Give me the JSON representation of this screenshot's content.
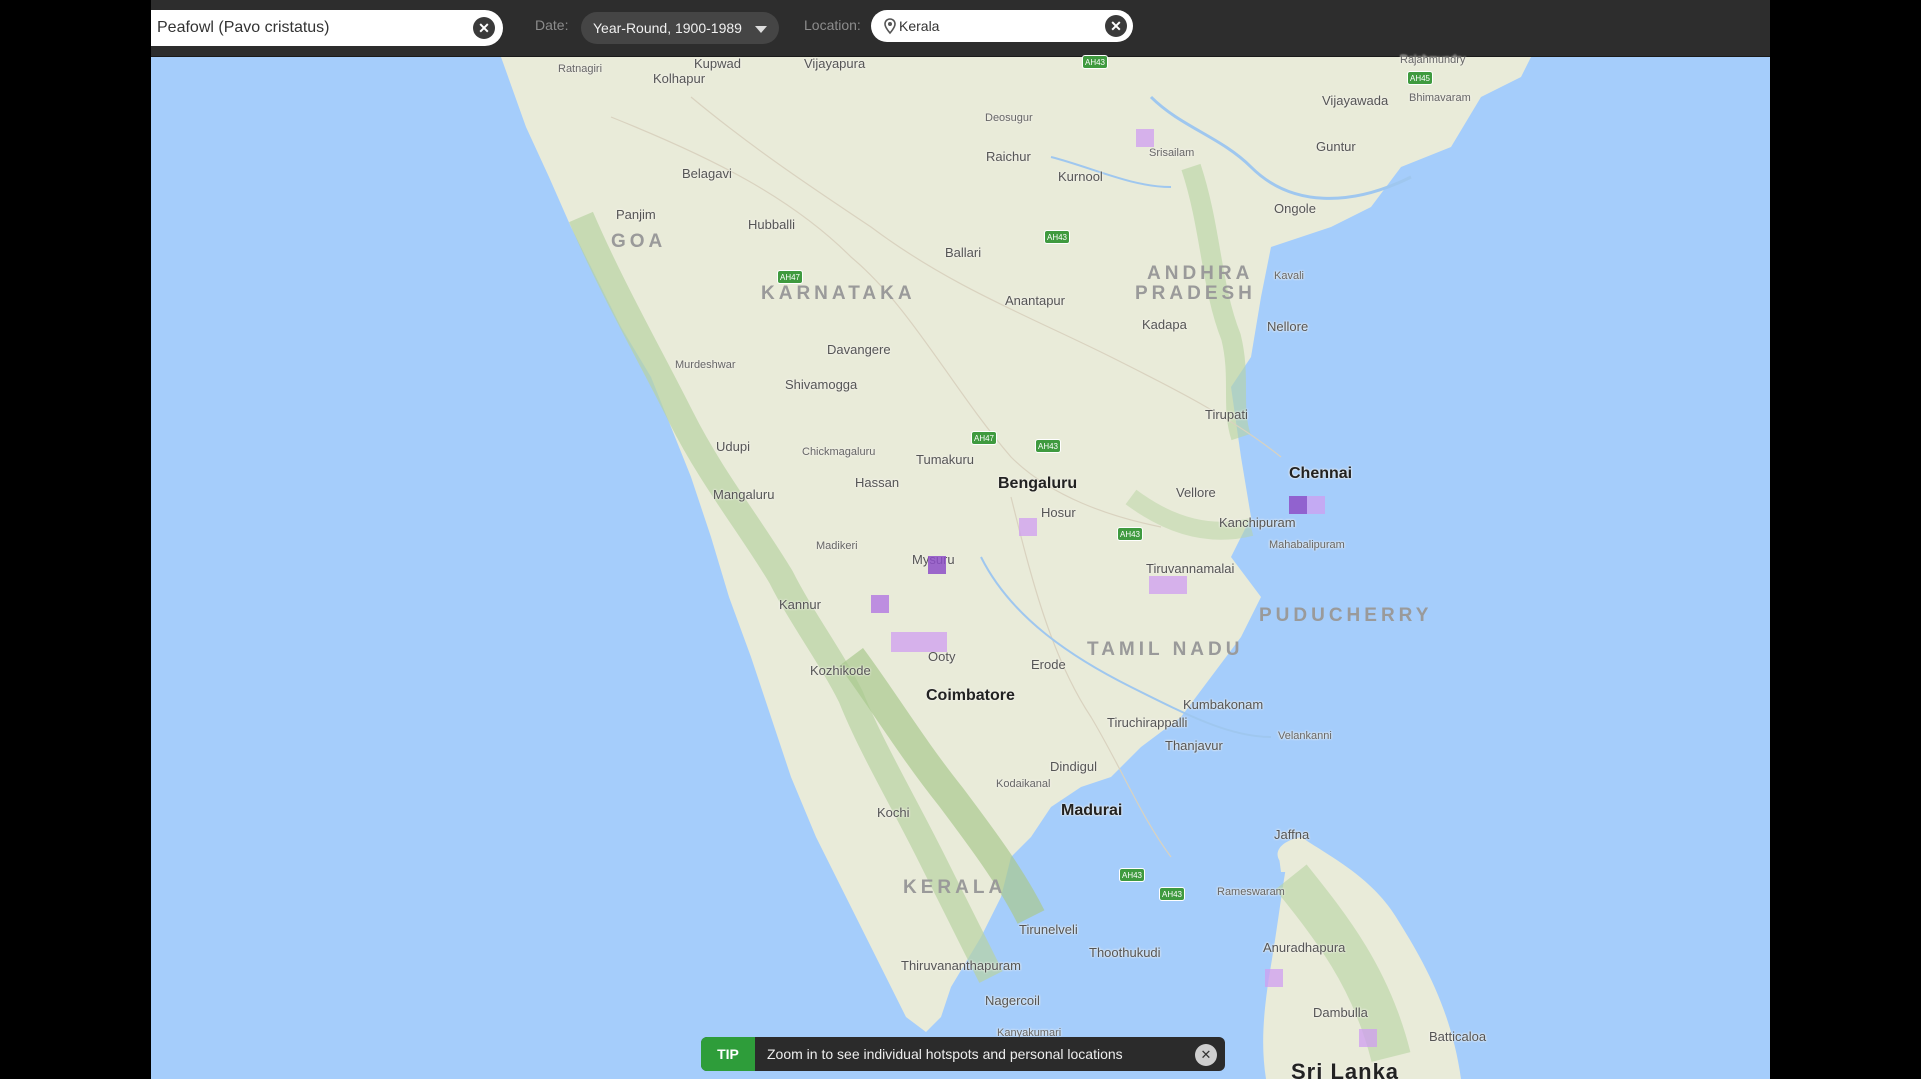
{
  "toolbar": {
    "species": "Peafowl (Pavo cristatus)",
    "date_label": "Date:",
    "date_value": "Year-Round, 1900-1989",
    "location_label": "Location:",
    "location_value": "Kerala"
  },
  "tip": {
    "badge": "TIP",
    "message": "Zoom in to see individual hotspots and personal locations"
  },
  "map": {
    "states": [
      "GOA",
      "KARNATAKA",
      "ANDHRA",
      "PRADESH",
      "TAMIL NADU",
      "PUDUCHERRY",
      "KERALA"
    ],
    "country": "Sri Lanka",
    "cities_major": [
      "Bengaluru",
      "Chennai",
      "Coimbatore",
      "Madurai"
    ],
    "cities": [
      "Ratnagiri",
      "Kolhapur",
      "Kupwad",
      "Vijayapura",
      "Belagavi",
      "Panjim",
      "Hubballi",
      "Deosugur",
      "Raichur",
      "Kurnool",
      "Srisailam",
      "Vijayawada",
      "Guntur",
      "Bhimavaram",
      "Rajahmundry",
      "Ongole",
      "Ballari",
      "Anantapur",
      "Kavali",
      "Kadapa",
      "Nellore",
      "Davangere",
      "Murdeshwar",
      "Shivamogga",
      "Tirupati",
      "Udupi",
      "Chickmagaluru",
      "Tumakuru",
      "Mangaluru",
      "Hassan",
      "Hosur",
      "Vellore",
      "Kanchipuram",
      "Mahabalipuram",
      "Madikeri",
      "Mysuru",
      "Tiruvannamalai",
      "Kannur",
      "Ooty",
      "Erode",
      "Kozhikode",
      "Kumbakonam",
      "Tiruchirappalli",
      "Thanjavur",
      "Velankanni",
      "Dindigul",
      "Kodaikanal",
      "Kochi",
      "Jaffna",
      "Rameswaram",
      "Tirunelveli",
      "Thoothukudi",
      "Anuradhapura",
      "Thiruvananthapuram",
      "Nagercoil",
      "Kanyakumari",
      "Dambulla",
      "Batticaloa"
    ],
    "highways": [
      "AH43",
      "AH45",
      "AH47"
    ]
  }
}
